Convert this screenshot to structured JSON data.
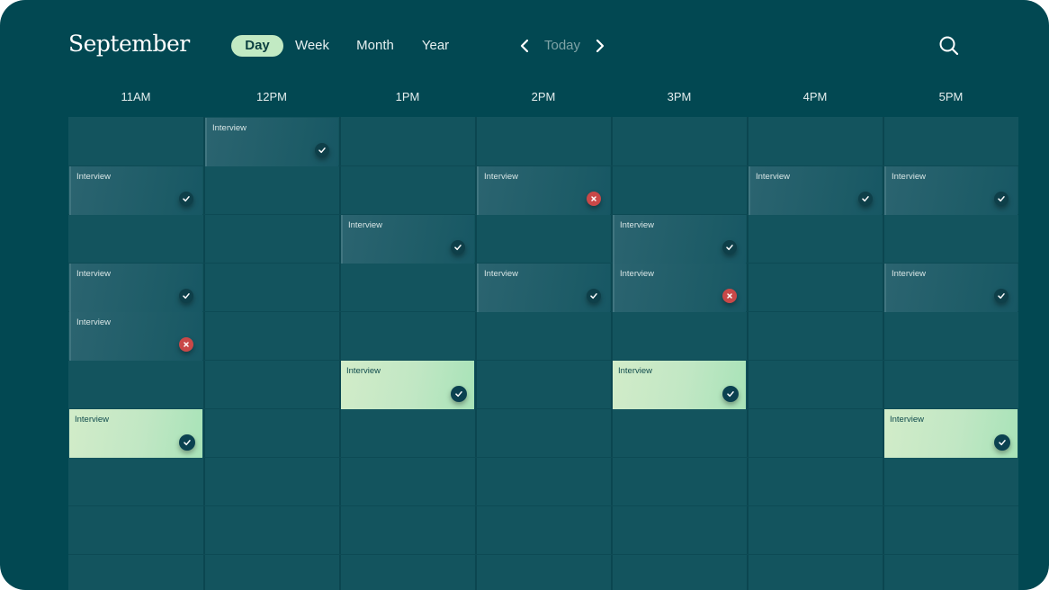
{
  "header": {
    "month": "September",
    "views": [
      {
        "label": "Day",
        "active": true
      },
      {
        "label": "Week",
        "active": false
      },
      {
        "label": "Month",
        "active": false
      },
      {
        "label": "Year",
        "active": false
      }
    ],
    "today_label": "Today",
    "icons": {
      "prev": "chevron-left-icon",
      "next": "chevron-right-icon",
      "search": "search-icon"
    }
  },
  "colors": {
    "background": "#024852",
    "grid": "#13545e",
    "active_tab": "#c2eac3",
    "event_dark": "#1c5b66",
    "event_light": "#c1e7c4",
    "status_ok": "#0e3f49",
    "status_fail": "#c94848"
  },
  "hours": [
    "11AM",
    "12PM",
    "1PM",
    "2PM",
    "3PM",
    "4PM",
    "5PM"
  ],
  "events": [
    {
      "label": "Interview",
      "hour": "12PM",
      "slot": 0,
      "style": "dark",
      "status": "confirmed"
    },
    {
      "label": "Interview",
      "hour": "11AM",
      "slot": 1,
      "style": "dark",
      "status": "confirmed"
    },
    {
      "label": "Interview",
      "hour": "2PM",
      "slot": 1,
      "style": "dark",
      "status": "declined"
    },
    {
      "label": "Interview",
      "hour": "4PM",
      "slot": 1,
      "style": "dark",
      "status": "confirmed"
    },
    {
      "label": "Interview",
      "hour": "5PM",
      "slot": 1,
      "style": "dark",
      "status": "confirmed"
    },
    {
      "label": "Interview",
      "hour": "1PM",
      "slot": 2,
      "style": "dark",
      "status": "confirmed"
    },
    {
      "label": "Interview",
      "hour": "3PM",
      "slot": 2,
      "style": "dark",
      "status": "confirmed"
    },
    {
      "label": "Interview",
      "hour": "11AM",
      "slot": 3,
      "style": "dark",
      "status": "confirmed"
    },
    {
      "label": "Interview",
      "hour": "2PM",
      "slot": 3,
      "style": "dark",
      "status": "confirmed"
    },
    {
      "label": "Interview",
      "hour": "3PM",
      "slot": 3,
      "style": "dark",
      "status": "declined"
    },
    {
      "label": "Interview",
      "hour": "5PM",
      "slot": 3,
      "style": "dark",
      "status": "confirmed"
    },
    {
      "label": "Interview",
      "hour": "11AM",
      "slot": 4,
      "style": "dark",
      "status": "declined"
    },
    {
      "label": "Interview",
      "hour": "1PM",
      "slot": 5,
      "style": "light",
      "status": "confirmed"
    },
    {
      "label": "Interview",
      "hour": "3PM",
      "slot": 5,
      "style": "light",
      "status": "confirmed"
    },
    {
      "label": "Interview",
      "hour": "11AM",
      "slot": 6,
      "style": "light",
      "status": "confirmed"
    },
    {
      "label": "Interview",
      "hour": "5PM",
      "slot": 6,
      "style": "light",
      "status": "confirmed"
    }
  ]
}
